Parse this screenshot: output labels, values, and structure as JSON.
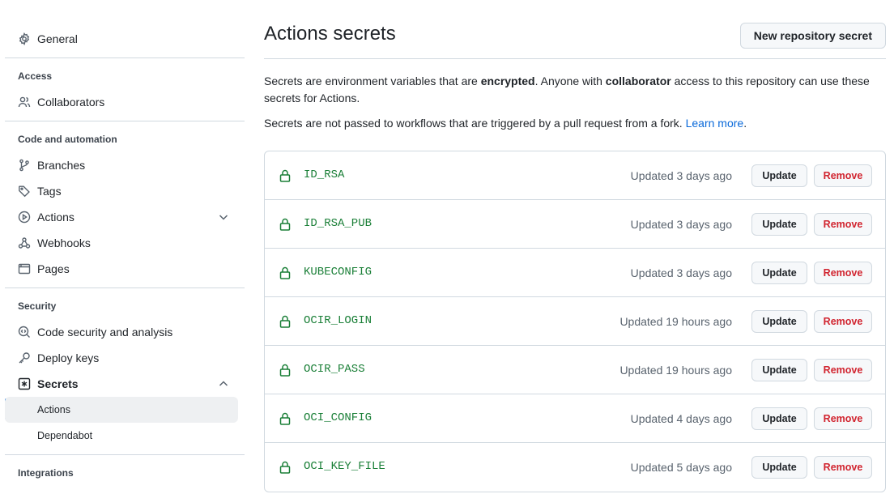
{
  "sidebar": {
    "general": "General",
    "access_heading": "Access",
    "collaborators": "Collaborators",
    "code_heading": "Code and automation",
    "branches": "Branches",
    "tags": "Tags",
    "actions": "Actions",
    "webhooks": "Webhooks",
    "pages": "Pages",
    "security_heading": "Security",
    "code_security": "Code security and analysis",
    "deploy_keys": "Deploy keys",
    "secrets": "Secrets",
    "secrets_actions": "Actions",
    "secrets_dependabot": "Dependabot",
    "integrations_heading": "Integrations"
  },
  "main": {
    "title": "Actions secrets",
    "new_secret_button": "New repository secret",
    "desc1_a": "Secrets are environment variables that are ",
    "desc1_b": "encrypted",
    "desc1_c": ". Anyone with ",
    "desc1_d": "collaborator",
    "desc1_e": " access to this repository can use these secrets for Actions.",
    "desc2_a": "Secrets are not passed to workflows that are triggered by a pull request from a fork. ",
    "desc2_link": "Learn more",
    "desc2_end": "."
  },
  "secrets": [
    {
      "name": "ID_RSA",
      "updated": "Updated 3 days ago",
      "update_label": "Update",
      "remove_label": "Remove"
    },
    {
      "name": "ID_RSA_PUB",
      "updated": "Updated 3 days ago",
      "update_label": "Update",
      "remove_label": "Remove"
    },
    {
      "name": "KUBECONFIG",
      "updated": "Updated 3 days ago",
      "update_label": "Update",
      "remove_label": "Remove"
    },
    {
      "name": "OCIR_LOGIN",
      "updated": "Updated 19 hours ago",
      "update_label": "Update",
      "remove_label": "Remove"
    },
    {
      "name": "OCIR_PASS",
      "updated": "Updated 19 hours ago",
      "update_label": "Update",
      "remove_label": "Remove"
    },
    {
      "name": "OCI_CONFIG",
      "updated": "Updated 4 days ago",
      "update_label": "Update",
      "remove_label": "Remove"
    },
    {
      "name": "OCI_KEY_FILE",
      "updated": "Updated 5 days ago",
      "update_label": "Update",
      "remove_label": "Remove"
    }
  ],
  "colors": {
    "accent": "#0969da",
    "secret_name": "#1a7f37",
    "danger": "#d1242f",
    "border": "#d1d9e0"
  }
}
